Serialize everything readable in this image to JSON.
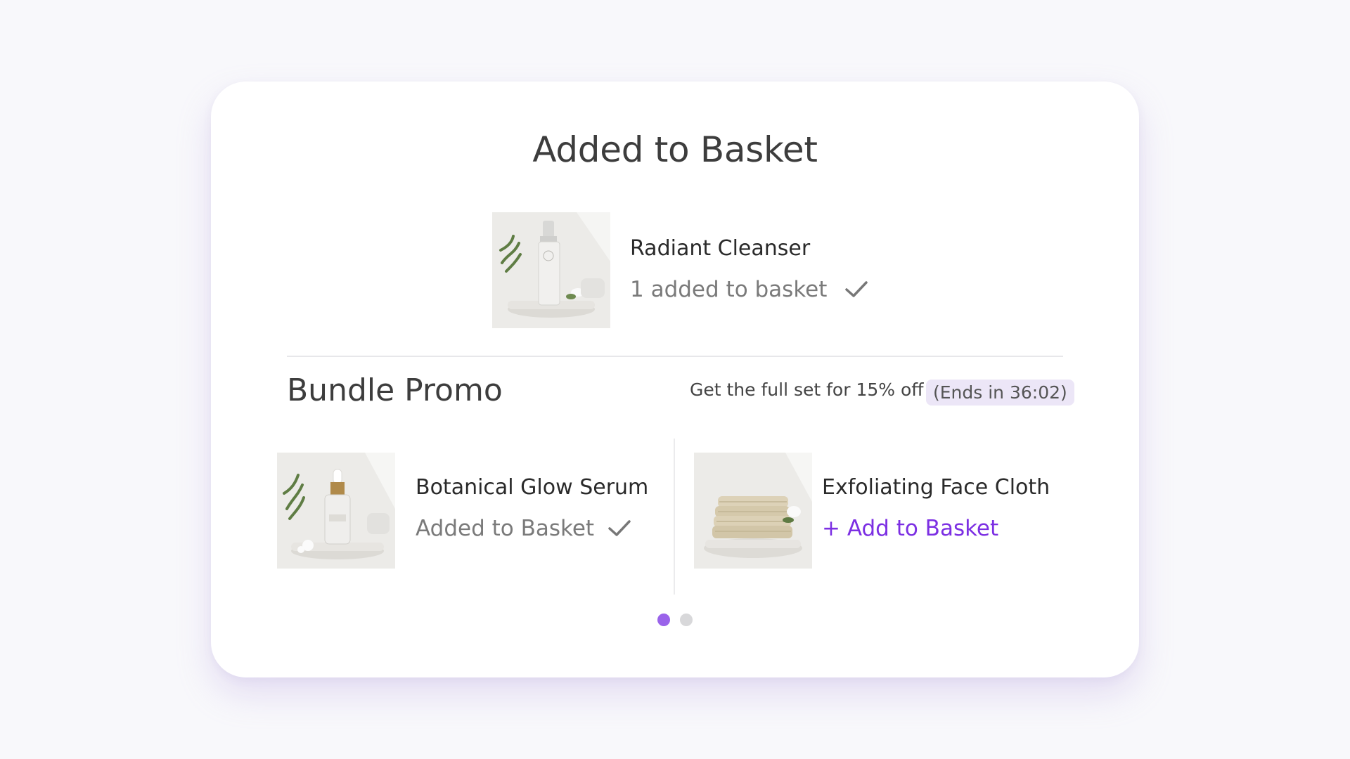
{
  "modal": {
    "title": "Added to Basket"
  },
  "main_item": {
    "name": "Radiant Cleanser",
    "status": "1 added to basket",
    "image_icon": "cleanser-bottle-image"
  },
  "promo": {
    "title": "Bundle Promo",
    "offer_text": "Get the full set for 15% off",
    "timer_text": "(Ends in 36:02)"
  },
  "bundle": {
    "items": [
      {
        "name": "Botanical Glow Serum",
        "status": "Added to Basket",
        "added": true,
        "image_icon": "serum-dropper-bottle-image"
      },
      {
        "name": "Exfoliating Face Cloth",
        "action": "+ Add to Basket",
        "added": false,
        "image_icon": "folded-face-cloths-image"
      }
    ]
  },
  "carousel": {
    "page_count": 2,
    "active_page": 1
  },
  "colors": {
    "accent": "#7c2fe3",
    "active_dot": "#9a63ea",
    "badge_bg": "#ece6f7",
    "background": "#f8f8fb"
  }
}
